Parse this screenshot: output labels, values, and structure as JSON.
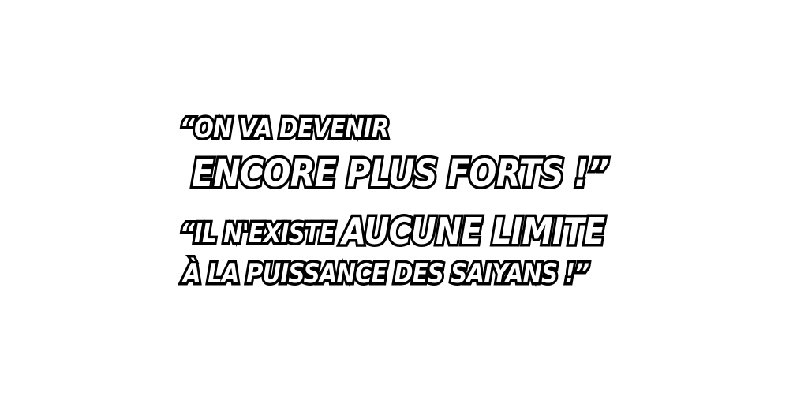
{
  "quotes": [
    {
      "line1": "“ON VA DEVENIR",
      "line2": "ENCORE PLUS FORTS !”"
    },
    {
      "line1_small": "“IL N'EXISTE ",
      "line1_big": "AUCUNE LIMITE",
      "line2": "À LA PUISSANCE DES SAIYANS !”"
    }
  ],
  "colors": {
    "background": "#ffffff",
    "text_fill": "#ffffff",
    "text_outline": "#000000"
  }
}
